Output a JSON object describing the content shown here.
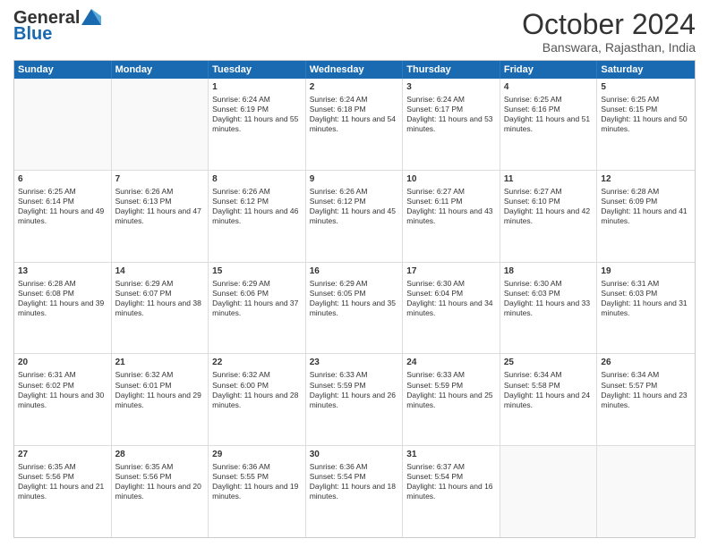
{
  "header": {
    "logo_general": "General",
    "logo_blue": "Blue",
    "month_title": "October 2024",
    "location": "Banswara, Rajasthan, India"
  },
  "days_of_week": [
    "Sunday",
    "Monday",
    "Tuesday",
    "Wednesday",
    "Thursday",
    "Friday",
    "Saturday"
  ],
  "weeks": [
    [
      {
        "day": "",
        "sunrise": "",
        "sunset": "",
        "daylight": ""
      },
      {
        "day": "",
        "sunrise": "",
        "sunset": "",
        "daylight": ""
      },
      {
        "day": "1",
        "sunrise": "Sunrise: 6:24 AM",
        "sunset": "Sunset: 6:19 PM",
        "daylight": "Daylight: 11 hours and 55 minutes."
      },
      {
        "day": "2",
        "sunrise": "Sunrise: 6:24 AM",
        "sunset": "Sunset: 6:18 PM",
        "daylight": "Daylight: 11 hours and 54 minutes."
      },
      {
        "day": "3",
        "sunrise": "Sunrise: 6:24 AM",
        "sunset": "Sunset: 6:17 PM",
        "daylight": "Daylight: 11 hours and 53 minutes."
      },
      {
        "day": "4",
        "sunrise": "Sunrise: 6:25 AM",
        "sunset": "Sunset: 6:16 PM",
        "daylight": "Daylight: 11 hours and 51 minutes."
      },
      {
        "day": "5",
        "sunrise": "Sunrise: 6:25 AM",
        "sunset": "Sunset: 6:15 PM",
        "daylight": "Daylight: 11 hours and 50 minutes."
      }
    ],
    [
      {
        "day": "6",
        "sunrise": "Sunrise: 6:25 AM",
        "sunset": "Sunset: 6:14 PM",
        "daylight": "Daylight: 11 hours and 49 minutes."
      },
      {
        "day": "7",
        "sunrise": "Sunrise: 6:26 AM",
        "sunset": "Sunset: 6:13 PM",
        "daylight": "Daylight: 11 hours and 47 minutes."
      },
      {
        "day": "8",
        "sunrise": "Sunrise: 6:26 AM",
        "sunset": "Sunset: 6:12 PM",
        "daylight": "Daylight: 11 hours and 46 minutes."
      },
      {
        "day": "9",
        "sunrise": "Sunrise: 6:26 AM",
        "sunset": "Sunset: 6:12 PM",
        "daylight": "Daylight: 11 hours and 45 minutes."
      },
      {
        "day": "10",
        "sunrise": "Sunrise: 6:27 AM",
        "sunset": "Sunset: 6:11 PM",
        "daylight": "Daylight: 11 hours and 43 minutes."
      },
      {
        "day": "11",
        "sunrise": "Sunrise: 6:27 AM",
        "sunset": "Sunset: 6:10 PM",
        "daylight": "Daylight: 11 hours and 42 minutes."
      },
      {
        "day": "12",
        "sunrise": "Sunrise: 6:28 AM",
        "sunset": "Sunset: 6:09 PM",
        "daylight": "Daylight: 11 hours and 41 minutes."
      }
    ],
    [
      {
        "day": "13",
        "sunrise": "Sunrise: 6:28 AM",
        "sunset": "Sunset: 6:08 PM",
        "daylight": "Daylight: 11 hours and 39 minutes."
      },
      {
        "day": "14",
        "sunrise": "Sunrise: 6:29 AM",
        "sunset": "Sunset: 6:07 PM",
        "daylight": "Daylight: 11 hours and 38 minutes."
      },
      {
        "day": "15",
        "sunrise": "Sunrise: 6:29 AM",
        "sunset": "Sunset: 6:06 PM",
        "daylight": "Daylight: 11 hours and 37 minutes."
      },
      {
        "day": "16",
        "sunrise": "Sunrise: 6:29 AM",
        "sunset": "Sunset: 6:05 PM",
        "daylight": "Daylight: 11 hours and 35 minutes."
      },
      {
        "day": "17",
        "sunrise": "Sunrise: 6:30 AM",
        "sunset": "Sunset: 6:04 PM",
        "daylight": "Daylight: 11 hours and 34 minutes."
      },
      {
        "day": "18",
        "sunrise": "Sunrise: 6:30 AM",
        "sunset": "Sunset: 6:03 PM",
        "daylight": "Daylight: 11 hours and 33 minutes."
      },
      {
        "day": "19",
        "sunrise": "Sunrise: 6:31 AM",
        "sunset": "Sunset: 6:03 PM",
        "daylight": "Daylight: 11 hours and 31 minutes."
      }
    ],
    [
      {
        "day": "20",
        "sunrise": "Sunrise: 6:31 AM",
        "sunset": "Sunset: 6:02 PM",
        "daylight": "Daylight: 11 hours and 30 minutes."
      },
      {
        "day": "21",
        "sunrise": "Sunrise: 6:32 AM",
        "sunset": "Sunset: 6:01 PM",
        "daylight": "Daylight: 11 hours and 29 minutes."
      },
      {
        "day": "22",
        "sunrise": "Sunrise: 6:32 AM",
        "sunset": "Sunset: 6:00 PM",
        "daylight": "Daylight: 11 hours and 28 minutes."
      },
      {
        "day": "23",
        "sunrise": "Sunrise: 6:33 AM",
        "sunset": "Sunset: 5:59 PM",
        "daylight": "Daylight: 11 hours and 26 minutes."
      },
      {
        "day": "24",
        "sunrise": "Sunrise: 6:33 AM",
        "sunset": "Sunset: 5:59 PM",
        "daylight": "Daylight: 11 hours and 25 minutes."
      },
      {
        "day": "25",
        "sunrise": "Sunrise: 6:34 AM",
        "sunset": "Sunset: 5:58 PM",
        "daylight": "Daylight: 11 hours and 24 minutes."
      },
      {
        "day": "26",
        "sunrise": "Sunrise: 6:34 AM",
        "sunset": "Sunset: 5:57 PM",
        "daylight": "Daylight: 11 hours and 23 minutes."
      }
    ],
    [
      {
        "day": "27",
        "sunrise": "Sunrise: 6:35 AM",
        "sunset": "Sunset: 5:56 PM",
        "daylight": "Daylight: 11 hours and 21 minutes."
      },
      {
        "day": "28",
        "sunrise": "Sunrise: 6:35 AM",
        "sunset": "Sunset: 5:56 PM",
        "daylight": "Daylight: 11 hours and 20 minutes."
      },
      {
        "day": "29",
        "sunrise": "Sunrise: 6:36 AM",
        "sunset": "Sunset: 5:55 PM",
        "daylight": "Daylight: 11 hours and 19 minutes."
      },
      {
        "day": "30",
        "sunrise": "Sunrise: 6:36 AM",
        "sunset": "Sunset: 5:54 PM",
        "daylight": "Daylight: 11 hours and 18 minutes."
      },
      {
        "day": "31",
        "sunrise": "Sunrise: 6:37 AM",
        "sunset": "Sunset: 5:54 PM",
        "daylight": "Daylight: 11 hours and 16 minutes."
      },
      {
        "day": "",
        "sunrise": "",
        "sunset": "",
        "daylight": ""
      },
      {
        "day": "",
        "sunrise": "",
        "sunset": "",
        "daylight": ""
      }
    ]
  ]
}
